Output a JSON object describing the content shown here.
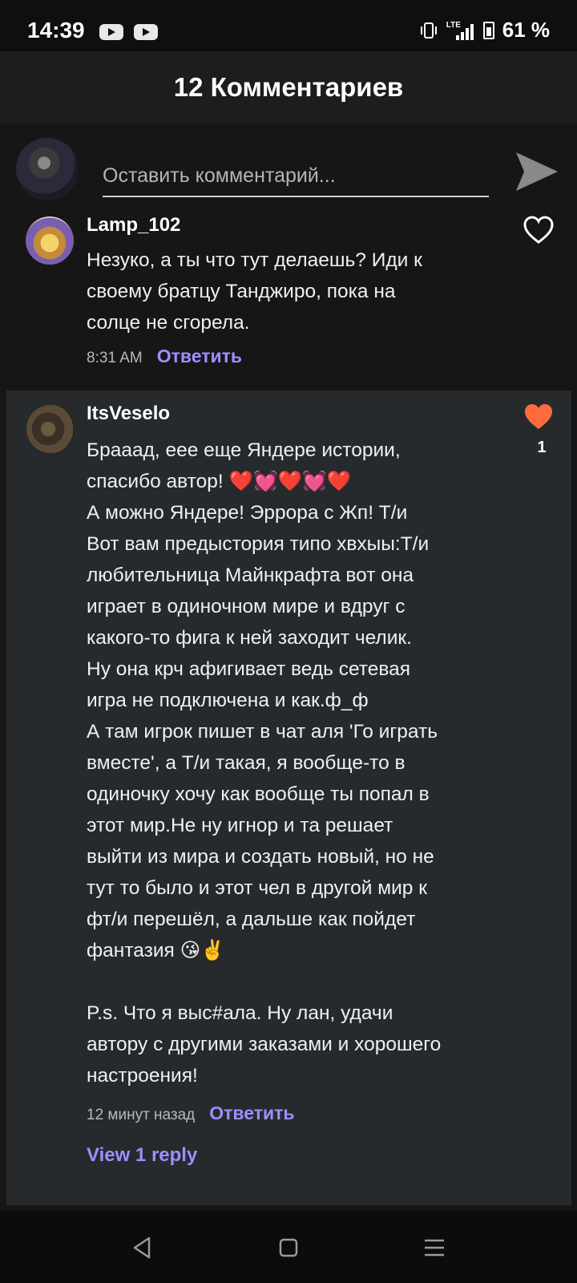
{
  "status_bar": {
    "time": "14:39",
    "battery_text": "61 %",
    "network_label": "LTE",
    "icons": [
      "youtube-icon",
      "youtube-icon",
      "vibrate-icon",
      "lte-signal-icon",
      "battery-icon"
    ]
  },
  "header": {
    "title": "12 Комментариев"
  },
  "compose": {
    "placeholder": "Оставить комментарий...",
    "send_icon": "send-icon"
  },
  "comments": [
    {
      "username": "Lamp_102",
      "text": "Незуко, а ты что тут делаешь? Иди к\nсвоему братцу Танджиро, пока на\nсолце не сгорела.",
      "time": "8:31 AM",
      "reply_label": "Ответить",
      "liked": false,
      "like_count": ""
    },
    {
      "username": "ItsVeselo",
      "text": "Брааад, еее еще Яндере истории,\nспасибо автор! ❤️💓❤️💓❤️\nА можно Яндере! Эррора с Жп! Т/и\nВот вам предыстория типо хвхыы:Т/и\nлюбительница Майнкрафта вот она\nиграет в одиночном мире и вдруг с\nкакого-то фига к ней заходит челик.\nНу она крч афигивает ведь сетевая\nигра не подключена и как.ф_ф\nА там игрок пишет в чат аля 'Го играть\nвместе', а Т/и такая, я вообще-то в\nодиночку хочу как вообще ты попал в\nэтот мир.Не ну игнор и та решает\nвыйти из мира и создать новый, но не\nтут то было и этот чел в другой мир к\nфт/и перешёл, а дальше как пойдет\nфантазия 😘✌️\n\nP.s. Что я выс#ала. Ну лан, удачи\nавтору с другими заказами и хорошего\nнастроения!",
      "time": "12 минут назад",
      "reply_label": "Ответить",
      "liked": true,
      "like_count": "1",
      "view_replies": "View 1 reply"
    }
  ],
  "colors": {
    "accent": "#9c90ff",
    "like": "#ff6b3d",
    "highlight_bg": "#262a2c"
  },
  "nav_bar": {
    "icons": [
      "back-icon",
      "home-icon",
      "recent-apps-icon"
    ]
  }
}
